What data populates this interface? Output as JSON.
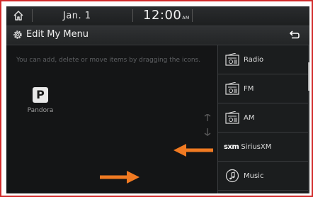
{
  "status": {
    "date": "Jan.  1",
    "time": "12:00",
    "ampm": "AM"
  },
  "header": {
    "title": "Edit My Menu"
  },
  "hint_text": "You can add, delete or move items by dragging the icons.",
  "apps": [
    {
      "icon_letter": "P",
      "label": "Pandora"
    }
  ],
  "menu": [
    {
      "label": "Radio",
      "icon": "radio-icon"
    },
    {
      "label": "FM",
      "icon": "radio-icon"
    },
    {
      "label": "AM",
      "icon": "radio-icon"
    },
    {
      "prefix": "sxm",
      "label": "SiriusXM",
      "icon": "siriusxm-logo"
    },
    {
      "label": "Music",
      "icon": "music-note-icon"
    }
  ],
  "colors": {
    "arrow": "#f07a22",
    "frame": "#d22b2b"
  }
}
